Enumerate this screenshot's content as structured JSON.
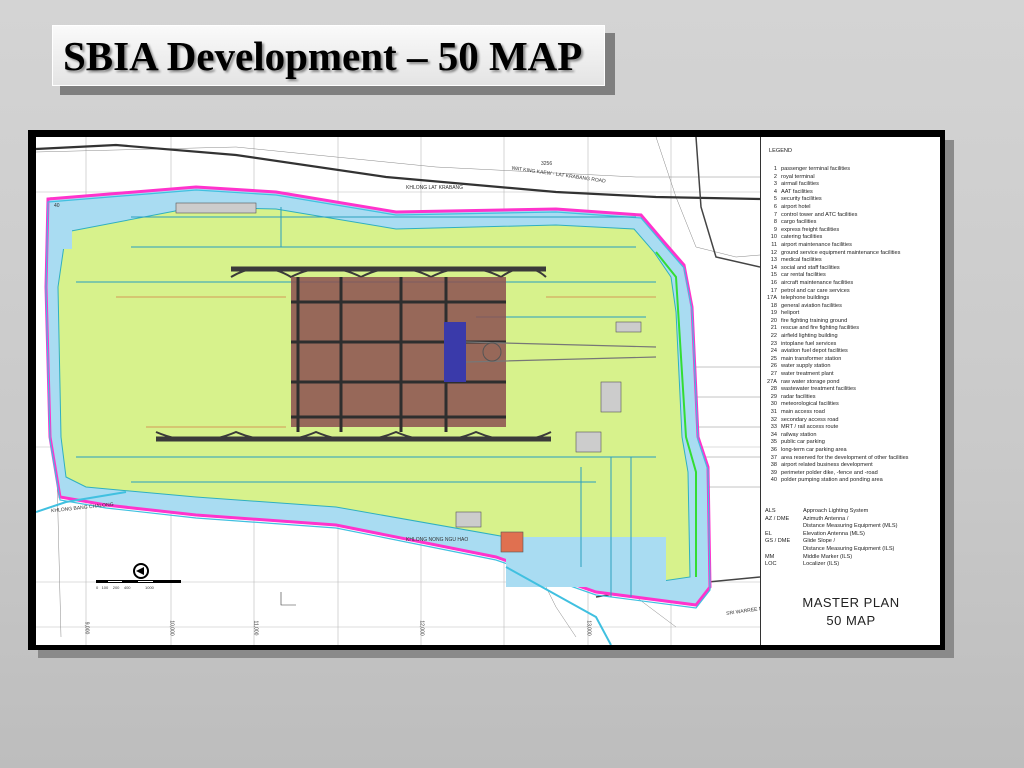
{
  "slide": {
    "title": "SBIA Development – 50 MAP"
  },
  "map": {
    "labels": {
      "khlong_lat_krabang": "KHLONG LAT KRABANG",
      "road_north": "WAT KING KAEW - LAT KRABANG ROAD",
      "road_number": "3256",
      "khlong_bang_chalong": "KHLONG BANG CHALONG",
      "khlong_nong_ngu_hao": "KHLONG NONG NGU HAO",
      "sri_warree_road": "SRI WARREE NOI ROAD",
      "polder_number": "40"
    },
    "grid_labels": [
      "9,000",
      "10,000",
      "11,000",
      "12,000",
      "13,000"
    ],
    "scale_bar": [
      "0",
      "100",
      "200",
      "400",
      "1000"
    ],
    "colors": {
      "airfield": "#d7f28c",
      "moat": "#a9dcf2",
      "perimeter": "#ff33cc",
      "runway": "#3a3a3a",
      "terminal": "#7a3030"
    }
  },
  "legend": {
    "title": "LEGEND",
    "items": [
      {
        "num": "1",
        "label": "passenger terminal facilities"
      },
      {
        "num": "2",
        "label": "royal terminal"
      },
      {
        "num": "3",
        "label": "airmail facilities"
      },
      {
        "num": "4",
        "label": "AAT facilities"
      },
      {
        "num": "5",
        "label": "security facilities"
      },
      {
        "num": "6",
        "label": "airport hotel"
      },
      {
        "num": "7",
        "label": "control tower and ATC facilities"
      },
      {
        "num": "8",
        "label": "cargo facilities"
      },
      {
        "num": "9",
        "label": "express freight facilities"
      },
      {
        "num": "10",
        "label": "catering facilities"
      },
      {
        "num": "11",
        "label": "airport maintenance facilities"
      },
      {
        "num": "12",
        "label": "ground service equipment maintenance facilities"
      },
      {
        "num": "13",
        "label": "medical facilities"
      },
      {
        "num": "14",
        "label": "social and staff facilities"
      },
      {
        "num": "15",
        "label": "car rental facilities"
      },
      {
        "num": "16",
        "label": "aircraft maintenance facilities"
      },
      {
        "num": "17",
        "label": "petrol and car care services"
      },
      {
        "num": "17A",
        "label": "telephone buildings"
      },
      {
        "num": "18",
        "label": "general aviation facilities"
      },
      {
        "num": "19",
        "label": "heliport"
      },
      {
        "num": "20",
        "label": "fire fighting training ground"
      },
      {
        "num": "21",
        "label": "rescue and fire fighting facilities"
      },
      {
        "num": "22",
        "label": "airfield lighting building"
      },
      {
        "num": "23",
        "label": "intoplane fuel services"
      },
      {
        "num": "24",
        "label": "aviation fuel depot facilities"
      },
      {
        "num": "25",
        "label": "main transformer station"
      },
      {
        "num": "26",
        "label": "water supply station"
      },
      {
        "num": "27",
        "label": "water treatment plant"
      },
      {
        "num": "27A",
        "label": "raw water storage pond"
      },
      {
        "num": "28",
        "label": "wastewater treatment facilities"
      },
      {
        "num": "29",
        "label": "radar facilities"
      },
      {
        "num": "30",
        "label": "meteorological facilities"
      },
      {
        "num": "31",
        "label": "main access road"
      },
      {
        "num": "32",
        "label": "secondary access road"
      },
      {
        "num": "33",
        "label": "MRT / rail access route"
      },
      {
        "num": "34",
        "label": "railway station"
      },
      {
        "num": "35",
        "label": "public car parking"
      },
      {
        "num": "36",
        "label": "long-term car parking area"
      },
      {
        "num": "37",
        "label": "area reserved for the development of other facilities"
      },
      {
        "num": "38",
        "label": "airport related business development"
      },
      {
        "num": "39",
        "label": "perimeter polder dike, -fence and -road"
      },
      {
        "num": "40",
        "label": "polder pumping station and ponding area"
      }
    ],
    "abbreviations": [
      {
        "code": "ALS",
        "label": "Approach Lighting System"
      },
      {
        "code": "AZ / DME",
        "label": "Azimuth Antenna /"
      },
      {
        "code": "",
        "label": "Distance Measuring Equipment (MLS)"
      },
      {
        "code": "EL",
        "label": "Elevation Antenna (MLS)"
      },
      {
        "code": "GS / DME",
        "label": "Glide Slope /"
      },
      {
        "code": "",
        "label": "Distance Measuring Equipment (ILS)"
      },
      {
        "code": "MM",
        "label": "Middle Marker (ILS)"
      },
      {
        "code": "LOC",
        "label": "Localizer (ILS)"
      }
    ],
    "master_plan": "MASTER PLAN",
    "plan_name": "50 MAP"
  }
}
